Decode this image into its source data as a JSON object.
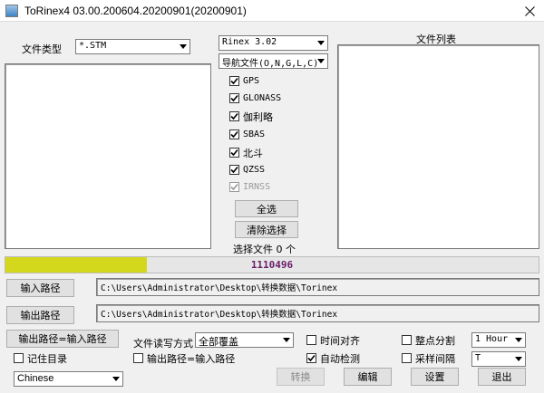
{
  "window": {
    "title": "ToRinex4 03.00.200604.20200901(20200901)"
  },
  "file_type": {
    "label": "文件类型",
    "value": "*.STM"
  },
  "rinex_version": {
    "value": "Rinex 3.02"
  },
  "nav_file": {
    "value": "导航文件(O,N,G,L,C)"
  },
  "systems": [
    {
      "label": "GPS",
      "checked": true,
      "enabled": true
    },
    {
      "label": "GLONASS",
      "checked": true,
      "enabled": true
    },
    {
      "label": "伽利略",
      "checked": true,
      "enabled": true
    },
    {
      "label": "SBAS",
      "checked": true,
      "enabled": true
    },
    {
      "label": "北斗",
      "checked": true,
      "enabled": true
    },
    {
      "label": "QZSS",
      "checked": true,
      "enabled": true
    },
    {
      "label": "IRNSS",
      "checked": true,
      "enabled": false
    }
  ],
  "buttons": {
    "select_all": "全选",
    "clear_selection": "清除选择",
    "input_path": "输入路径",
    "output_path": "输出路径",
    "out_eq_in": "输出路径=输入路径",
    "convert": "转换",
    "edit": "编辑",
    "settings": "设置",
    "exit": "退出"
  },
  "selected_count": {
    "text": "选择文件 0 个"
  },
  "file_list": {
    "label": "文件列表"
  },
  "progress": {
    "text": "1110496",
    "fraction": 0.265
  },
  "paths": {
    "input": "C:\\Users\\Administrator\\Desktop\\转换数据\\Torinex",
    "output": "C:\\Users\\Administrator\\Desktop\\转换数据\\Torinex"
  },
  "write_mode": {
    "label": "文件读写方式",
    "value": "全部覆盖"
  },
  "options": {
    "time_align": {
      "label": "时间对齐",
      "checked": false
    },
    "auto_detect": {
      "label": "自动检测",
      "checked": true
    },
    "hour_split": {
      "label": "整点分割",
      "checked": false
    },
    "sample_interval": {
      "label": "采样间隔",
      "checked": false
    },
    "remember_dir": {
      "label": "记住目录",
      "checked": false
    },
    "out_eq_in_chk": {
      "label": "输出路径=输入路径",
      "checked": false
    }
  },
  "split_interval": {
    "value": "1 Hour"
  },
  "sample_value": {
    "value": "T"
  },
  "language": {
    "value": "Chinese"
  },
  "colors": {
    "progress_fill": "#d4d81c",
    "progress_text": "#6a1d6a"
  }
}
